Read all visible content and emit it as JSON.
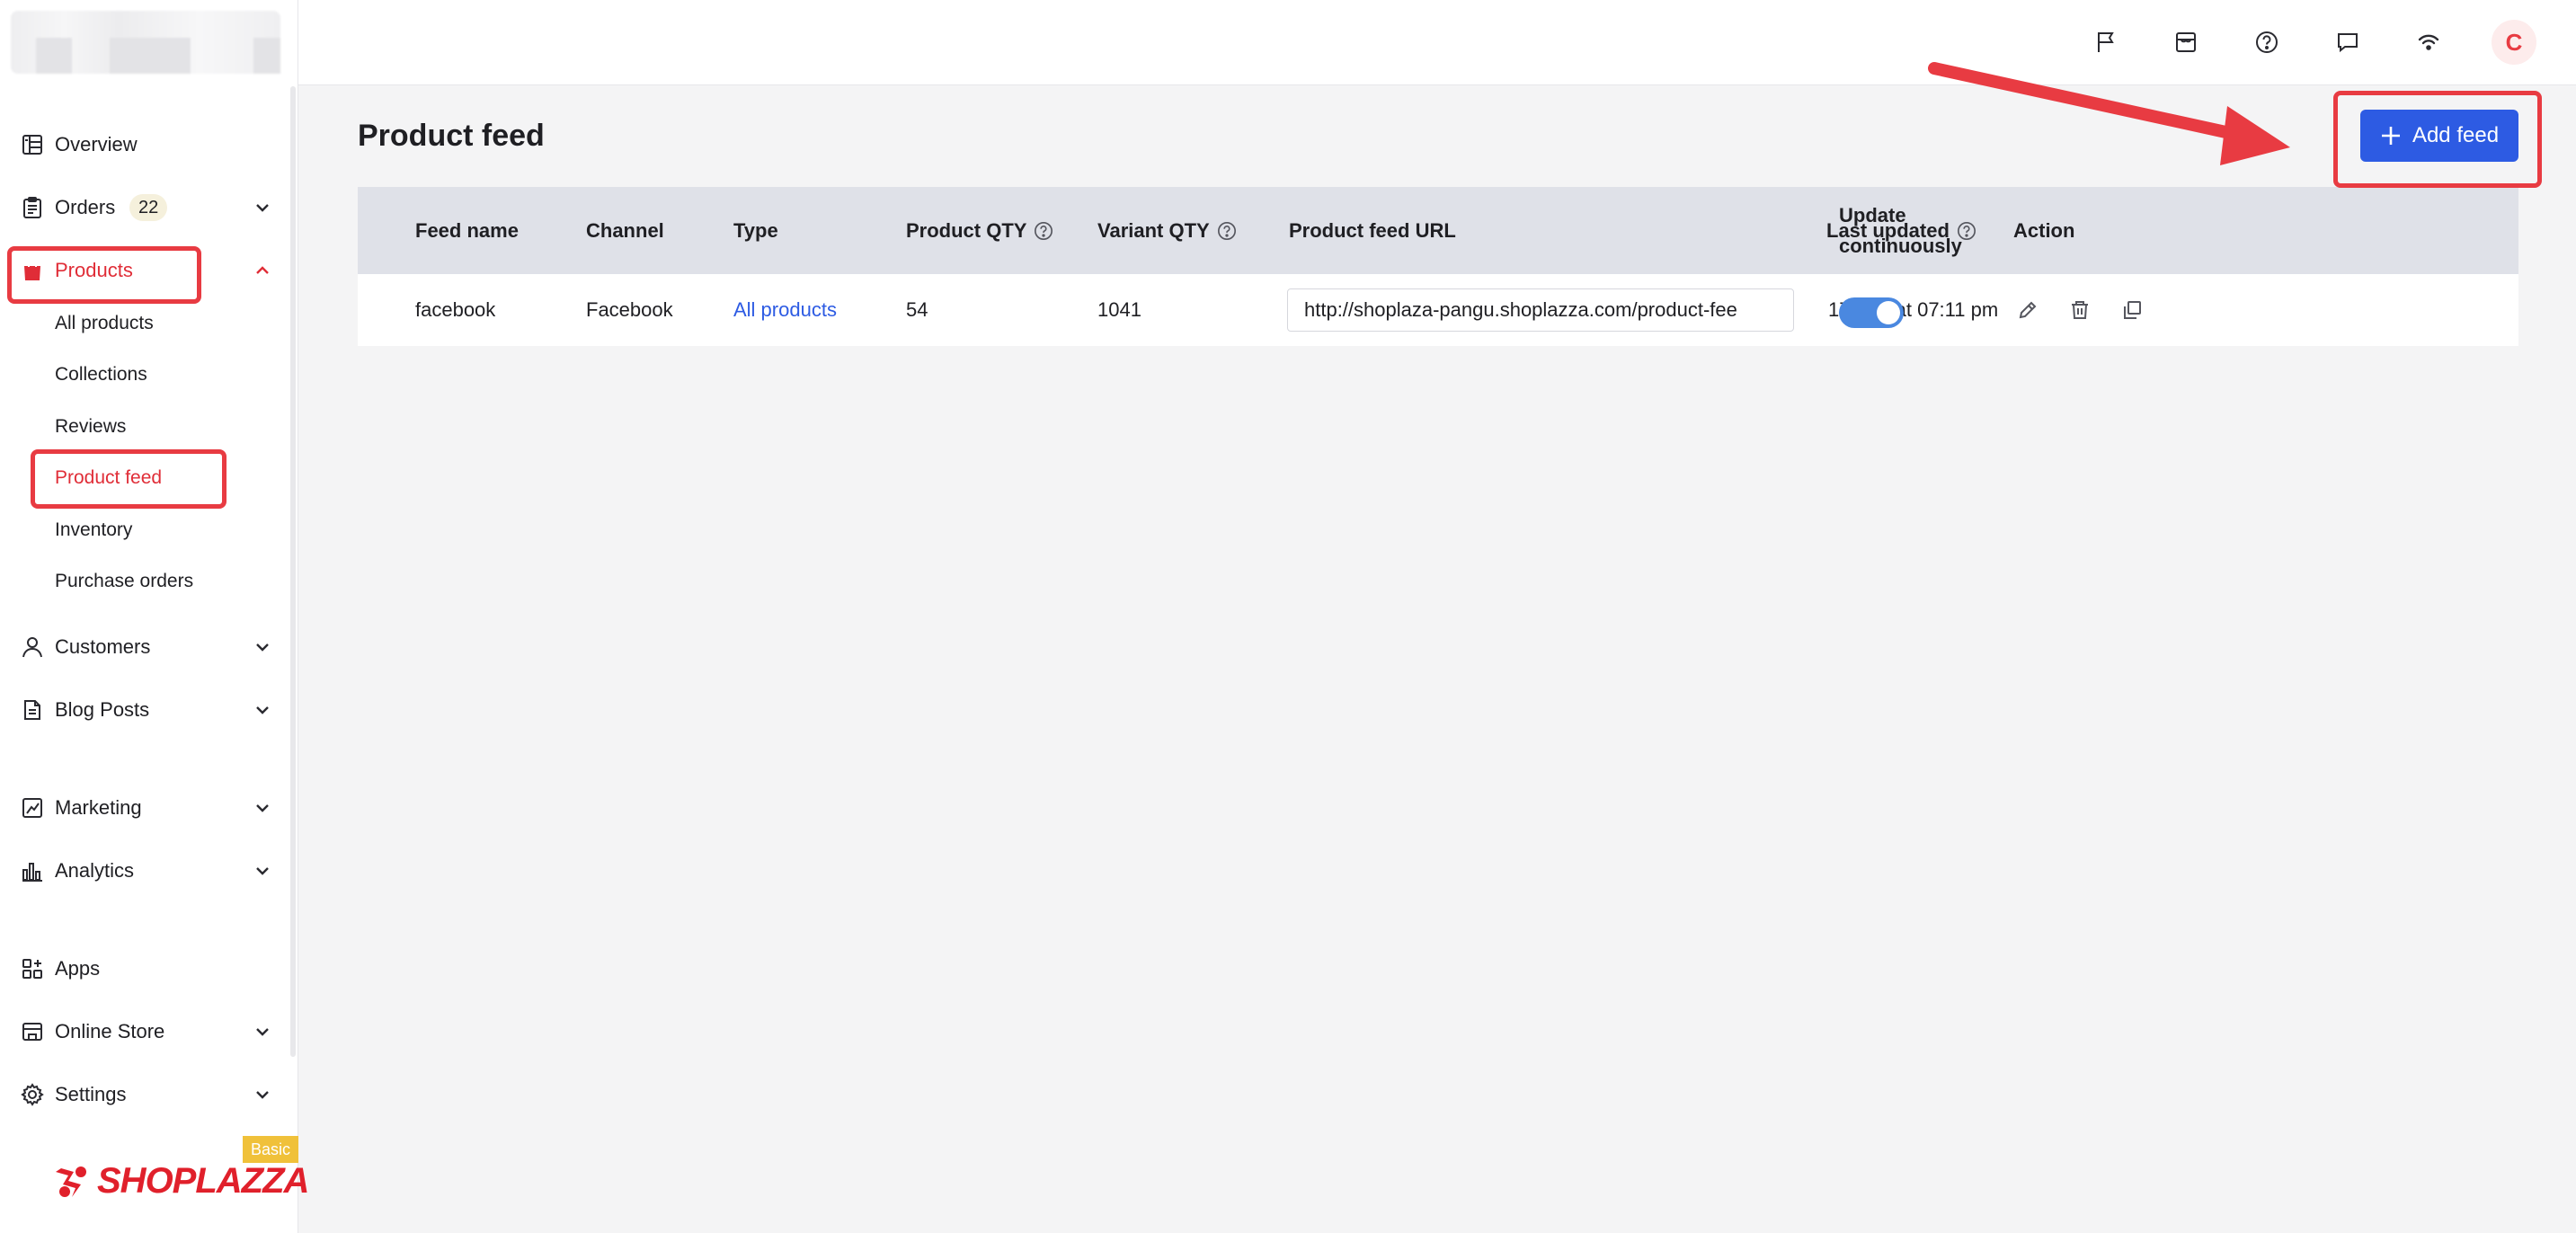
{
  "sidebar": {
    "items": {
      "overview": "Overview",
      "orders": "Orders",
      "orders_badge": "22",
      "products": "Products",
      "customers": "Customers",
      "blog_posts": "Blog Posts",
      "marketing": "Marketing",
      "analytics": "Analytics",
      "apps": "Apps",
      "online_store": "Online Store",
      "settings": "Settings"
    },
    "products_sub": {
      "all_products": "All products",
      "collections": "Collections",
      "reviews": "Reviews",
      "product_feed": "Product feed",
      "inventory": "Inventory",
      "purchase_orders": "Purchase orders"
    },
    "brand": "SHOPLAZZA",
    "plan": "Basic"
  },
  "topbar": {
    "avatar_initial": "C",
    "icons": [
      "flag-icon",
      "store-icon",
      "help-icon",
      "chat-icon",
      "wifi-icon"
    ]
  },
  "page": {
    "title": "Product feed",
    "add_button": "Add feed"
  },
  "table": {
    "headers": {
      "feed_name": "Feed name",
      "channel": "Channel",
      "type": "Type",
      "product_qty": "Product QTY",
      "variant_qty": "Variant QTY",
      "url": "Product feed URL",
      "last_updated": "Last updated",
      "update_line1": "Update",
      "update_line2": "continuously",
      "action": "Action"
    },
    "rows": [
      {
        "feed_name": "facebook",
        "channel": "Facebook",
        "type": "All products",
        "product_qty": "54",
        "variant_qty": "1041",
        "url": "http://shoplaza-pangu.shoplazza.com/product-fee",
        "last_updated": "17 Aug at 07:11 pm",
        "update_continuously": true
      }
    ]
  },
  "colors": {
    "accent_red": "#e02d37",
    "primary_blue": "#2d5be3",
    "toggle_blue": "#4a88e0",
    "annotation_red": "#e83b42"
  }
}
